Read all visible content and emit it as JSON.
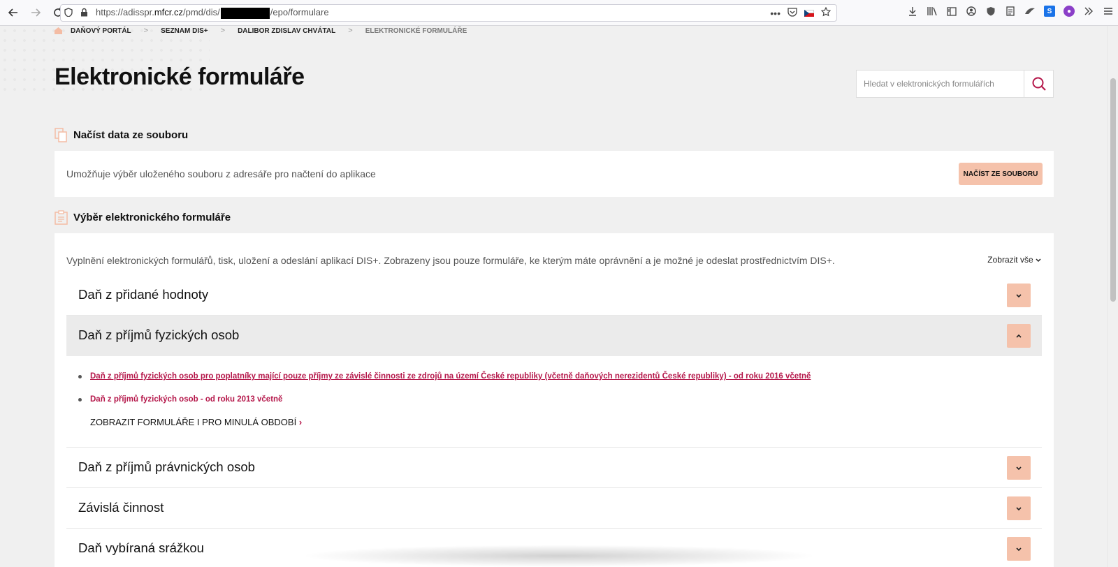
{
  "browser": {
    "url_prefix": "https://adisspr.",
    "url_host": "mfcr.cz",
    "url_path": "/pmd/dis/",
    "url_suffix": "/epo/formulare"
  },
  "breadcrumb": {
    "items": [
      "DAŇOVÝ PORTÁL",
      "SEZNAM DIS+",
      "DALIBOR ZDISLAV CHVÁTAL"
    ],
    "current": "ELEKTRONICKÉ FORMULÁŘE",
    "separator": ">"
  },
  "page_title": "Elektronické formuláře",
  "search": {
    "placeholder": "Hledat v elektronických formulářích"
  },
  "load_section": {
    "heading": "Načíst data ze souboru",
    "description": "Umožňuje výběr uloženého souboru z adresáře pro načtení do aplikace",
    "button_label": "NAČÍST ZE SOUBORU"
  },
  "forms_section": {
    "heading": "Výběr elektronického formuláře",
    "description": "Vyplnění elektronických formulářů, tisk, uložení a odeslání aplikací DIS+. Zobrazeny jsou pouze formuláře, ke kterým máte oprávnění a je možné je odeslat prostřednictvím DIS+.",
    "show_all": "Zobrazit vše",
    "accordions": [
      {
        "title": "Daň z přidané hodnoty",
        "expanded": false
      },
      {
        "title": "Daň z příjmů fyzických osob",
        "expanded": true
      },
      {
        "title": "Daň z příjmů právnických osob",
        "expanded": false
      },
      {
        "title": "Závislá činnost",
        "expanded": false
      },
      {
        "title": "Daň vybíraná srážkou",
        "expanded": false
      }
    ],
    "expanded_links": [
      "Daň z příjmů fyzických osob pro poplatníky mající pouze příjmy ze závislé činnosti ze zdrojů na území České republiky (včetně daňových nerezidentů České republiky) - od roku 2016 včetně",
      "Daň z příjmů fyzických osob - od roku 2013 včetně"
    ],
    "show_previous": "ZOBRAZIT FORMULÁŘE I PRO MINULÁ OBDOBÍ",
    "show_previous_arrow": "›"
  },
  "colors": {
    "accent": "#b5174a",
    "button_bg": "#f5c2ab",
    "page_bg": "#f0f0f0"
  }
}
